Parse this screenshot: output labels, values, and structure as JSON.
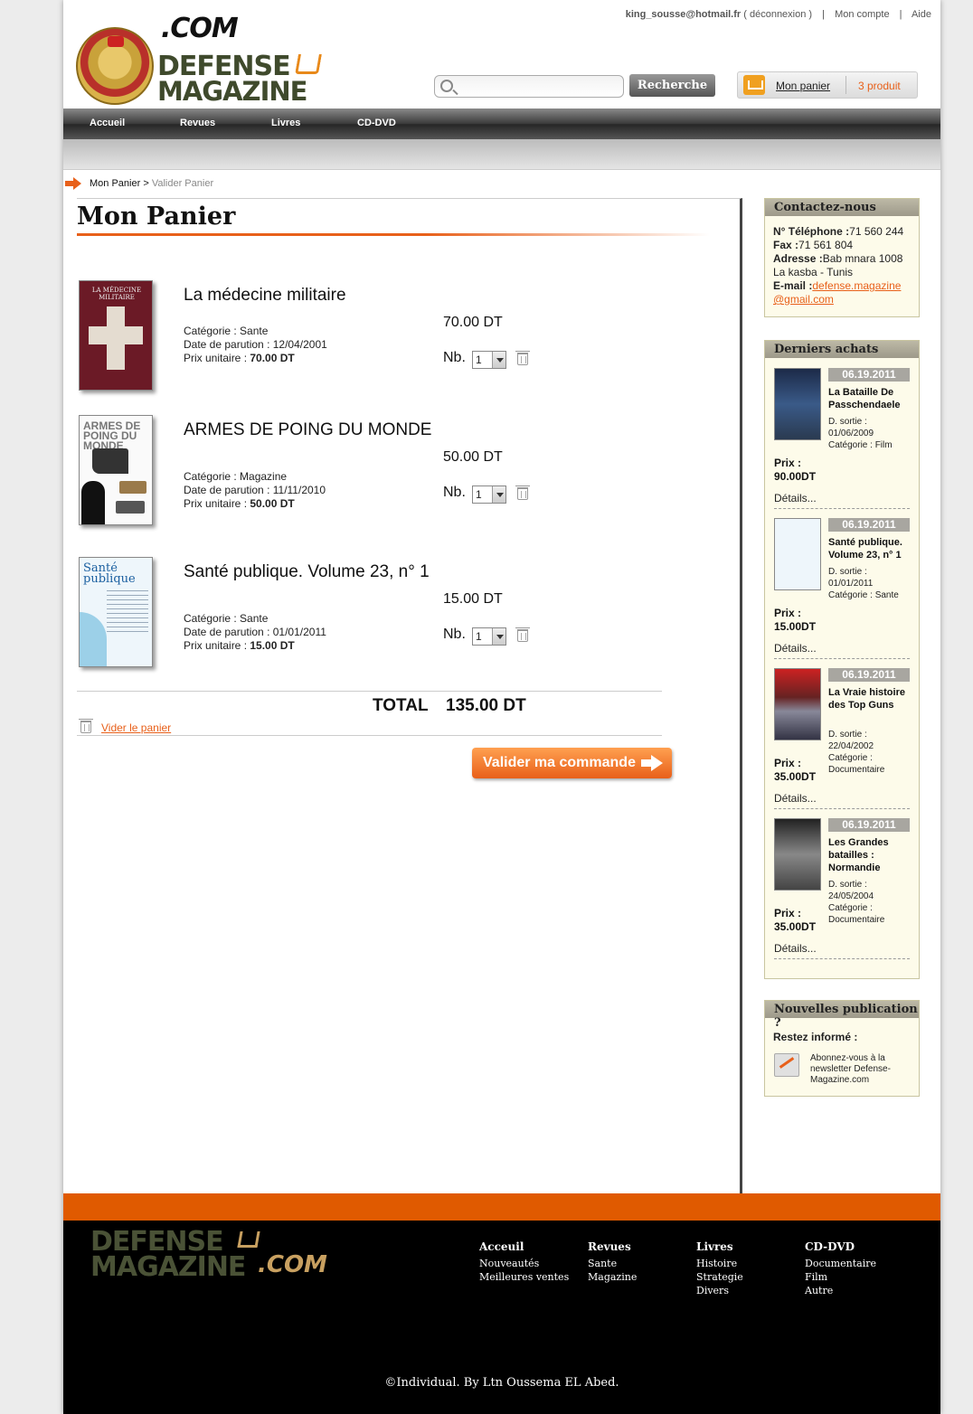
{
  "header": {
    "user_email": "king_sousse@hotmail.fr",
    "logout": "( déconnexion )",
    "separator": "|",
    "account": "Mon compte",
    "help": "Aide",
    "logo_com": ".COM",
    "logo_line1": "DEFENSE",
    "logo_line2": "MAGAZINE",
    "search_placeholder": "",
    "search_button": "Recherche",
    "cart_label": "Mon panier",
    "cart_count": "3 produit"
  },
  "nav": [
    "Accueil",
    "Revues",
    "Livres",
    "CD-DVD"
  ],
  "breadcrumb": {
    "root": "Mon Panier",
    "sep": ">",
    "current": "Valider Panier"
  },
  "main": {
    "title": "Mon Panier",
    "items": [
      {
        "title": "La médecine militaire",
        "cover_text": "LA MÉDECINE MILITAIRE",
        "category": "Catégorie : Sante",
        "date": "Date de parution : 12/04/2001",
        "unit_label": "Prix unitaire : ",
        "unit_price": "70.00 DT",
        "price": "70.00 DT",
        "nb_label": "Nb.",
        "qty": "1"
      },
      {
        "title": "ARMES DE POING DU MONDE",
        "cover_text": "ARMES DE POING DU MONDE",
        "category": "Catégorie : Magazine",
        "date": "Date de parution : 11/11/2010",
        "unit_label": "Prix unitaire : ",
        "unit_price": "50.00 DT",
        "price": "50.00 DT",
        "nb_label": "Nb.",
        "qty": "1"
      },
      {
        "title": "Santé publique. Volume 23, n° 1",
        "cover_text": "Santé publique",
        "category": "Catégorie : Sante",
        "date": "Date de parution : 01/01/2011",
        "unit_label": "Prix unitaire : ",
        "unit_price": "15.00 DT",
        "price": "15.00 DT",
        "nb_label": "Nb.",
        "qty": "1"
      }
    ],
    "total_label": "TOTAL",
    "total_value": "135.00 DT",
    "empty_cart": "Vider le panier",
    "validate": "Valider ma commande"
  },
  "contact": {
    "title": "Contactez-nous",
    "phone_label": "N° Téléphone :",
    "phone": "71 560 244",
    "fax_label": "Fax :",
    "fax": "71 561 804",
    "address_label": "Adresse :",
    "address": "Bab mnara 1008",
    "city": "La kasba - Tunis",
    "email_label": "E-mail :",
    "email": "defense.magazine@gmail.com"
  },
  "recent": {
    "title": "Derniers achats",
    "price_label": "Prix :",
    "details": "Détails...",
    "items": [
      {
        "date": "06.19.2011",
        "title": "La Bataille De Passchendaele",
        "release_label": "D. sortie :",
        "release": "01/06/2009",
        "category": "Catégorie : Film",
        "price": "90.00DT"
      },
      {
        "date": "06.19.2011",
        "title": "Santé publique. Volume 23, n° 1",
        "release_label": "D. sortie :",
        "release": "01/01/2011",
        "category": "Catégorie : Sante",
        "price": "15.00DT"
      },
      {
        "date": "06.19.2011",
        "title": "La Vraie histoire des Top Guns",
        "release_label": "D. sortie :",
        "release": "22/04/2002",
        "category": "Catégorie : Documentaire",
        "price": "35.00DT"
      },
      {
        "date": "06.19.2011",
        "title": "Les Grandes batailles : Normandie",
        "release_label": "D. sortie :",
        "release": "24/05/2004",
        "category": "Catégorie : Documentaire",
        "price": "35.00DT"
      }
    ]
  },
  "newsletter": {
    "title": "Nouvelles publication ?",
    "lead": "Restez informé :",
    "text": "Abonnez-vous à la newsletter Defense-Magazine.com"
  },
  "footer": {
    "logo_line1": "DEFENSE",
    "logo_line2": "MAGAZINE",
    "logo_com": ".COM",
    "columns": [
      {
        "heading": "Acceuil",
        "links": [
          "Nouveautés",
          "Meilleures ventes"
        ]
      },
      {
        "heading": "Revues",
        "links": [
          "Sante",
          "Magazine"
        ]
      },
      {
        "heading": "Livres",
        "links": [
          "Histoire",
          "Strategie",
          "Divers"
        ]
      },
      {
        "heading": "CD-DVD",
        "links": [
          "Documentaire",
          "Film",
          "Autre"
        ]
      }
    ],
    "copyright": "©Individual. By Ltn Oussema EL Abed."
  }
}
